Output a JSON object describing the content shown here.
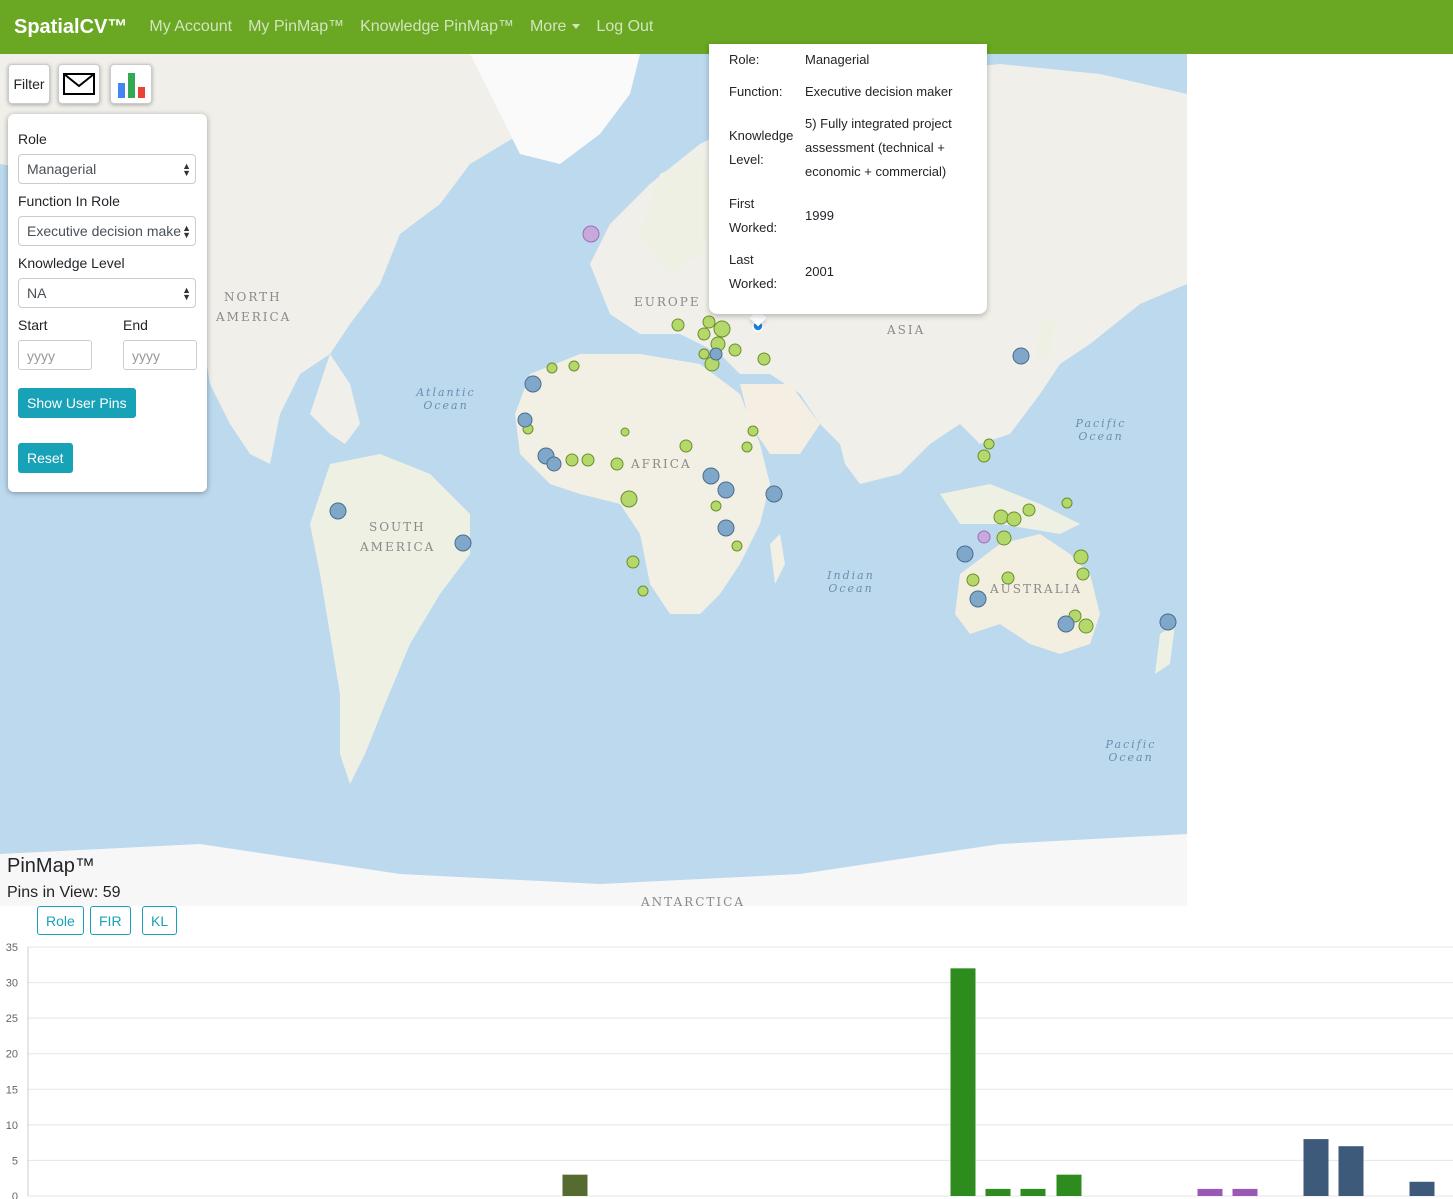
{
  "navbar": {
    "brand": "SpatialCV™",
    "items": [
      "My Account",
      "My PinMap™",
      "Knowledge PinMap™",
      "More",
      "Log Out"
    ]
  },
  "toolbar": {
    "filter_label": "Filter",
    "mail_icon": "envelope-icon",
    "chart_icon": "bar-chart-icon"
  },
  "filter": {
    "role_label": "Role",
    "role_value": "Managerial",
    "function_label": "Function In Role",
    "function_value": "Executive decision maker",
    "knowledge_label": "Knowledge Level",
    "knowledge_value": "NA",
    "start_label": "Start",
    "end_label": "End",
    "start_placeholder": "yyyy",
    "end_placeholder": "yyyy",
    "show_button": "Show User Pins",
    "reset_button": "Reset"
  },
  "popup": {
    "role_key": "Role:",
    "role_val": "Managerial",
    "function_key": "Function:",
    "function_val": "Executive decision maker",
    "knowledge_key_1": "Knowledge",
    "knowledge_key_2": "Level:",
    "knowledge_val_1": "5) Fully integrated project",
    "knowledge_val_2": "assessment (technical +",
    "knowledge_val_3": "economic + commercial)",
    "first_key_1": "First",
    "first_key_2": "Worked:",
    "first_val": "1999",
    "last_key_1": "Last",
    "last_key_2": "Worked:",
    "last_val": "2001"
  },
  "map": {
    "labels": {
      "north_america_1": "NORTH",
      "north_america_2": "AMERICA",
      "south_america_1": "SOUTH",
      "south_america_2": "AMERICA",
      "europe": "EUROPE",
      "asia": "ASIA",
      "africa": "AFRICA",
      "australia": "AUSTRALIA",
      "antarctica": "ANTARCTICA",
      "atlantic_1": "Atlantic",
      "atlantic_2": "Ocean",
      "indian_1": "Indian",
      "indian_2": "Ocean",
      "pacific_1": "Pacific",
      "pacific_2": "Ocean"
    }
  },
  "pinmap": {
    "title": "PinMap™",
    "count_text": "Pins in View: 59",
    "buttons": [
      "Role",
      "FIR",
      "KL"
    ]
  },
  "chart_data": {
    "type": "bar",
    "y_ticks": [
      "35",
      "30",
      "25",
      "20",
      "15",
      "10",
      "5",
      "0"
    ],
    "ylim": [
      0,
      35
    ],
    "bars": [
      {
        "value": 3,
        "color": "#556b2f"
      },
      {
        "value": 32,
        "color": "#2e8b1e"
      },
      {
        "value": 1,
        "color": "#2e8b1e"
      },
      {
        "value": 1,
        "color": "#2e8b1e"
      },
      {
        "value": 3,
        "color": "#2e8b1e"
      },
      {
        "value": 1,
        "color": "#9b59b6"
      },
      {
        "value": 1,
        "color": "#9b59b6"
      },
      {
        "value": 8,
        "color": "#3d5a7a"
      },
      {
        "value": 7,
        "color": "#3d5a7a"
      },
      {
        "value": 2,
        "color": "#3d5a7a"
      }
    ]
  }
}
